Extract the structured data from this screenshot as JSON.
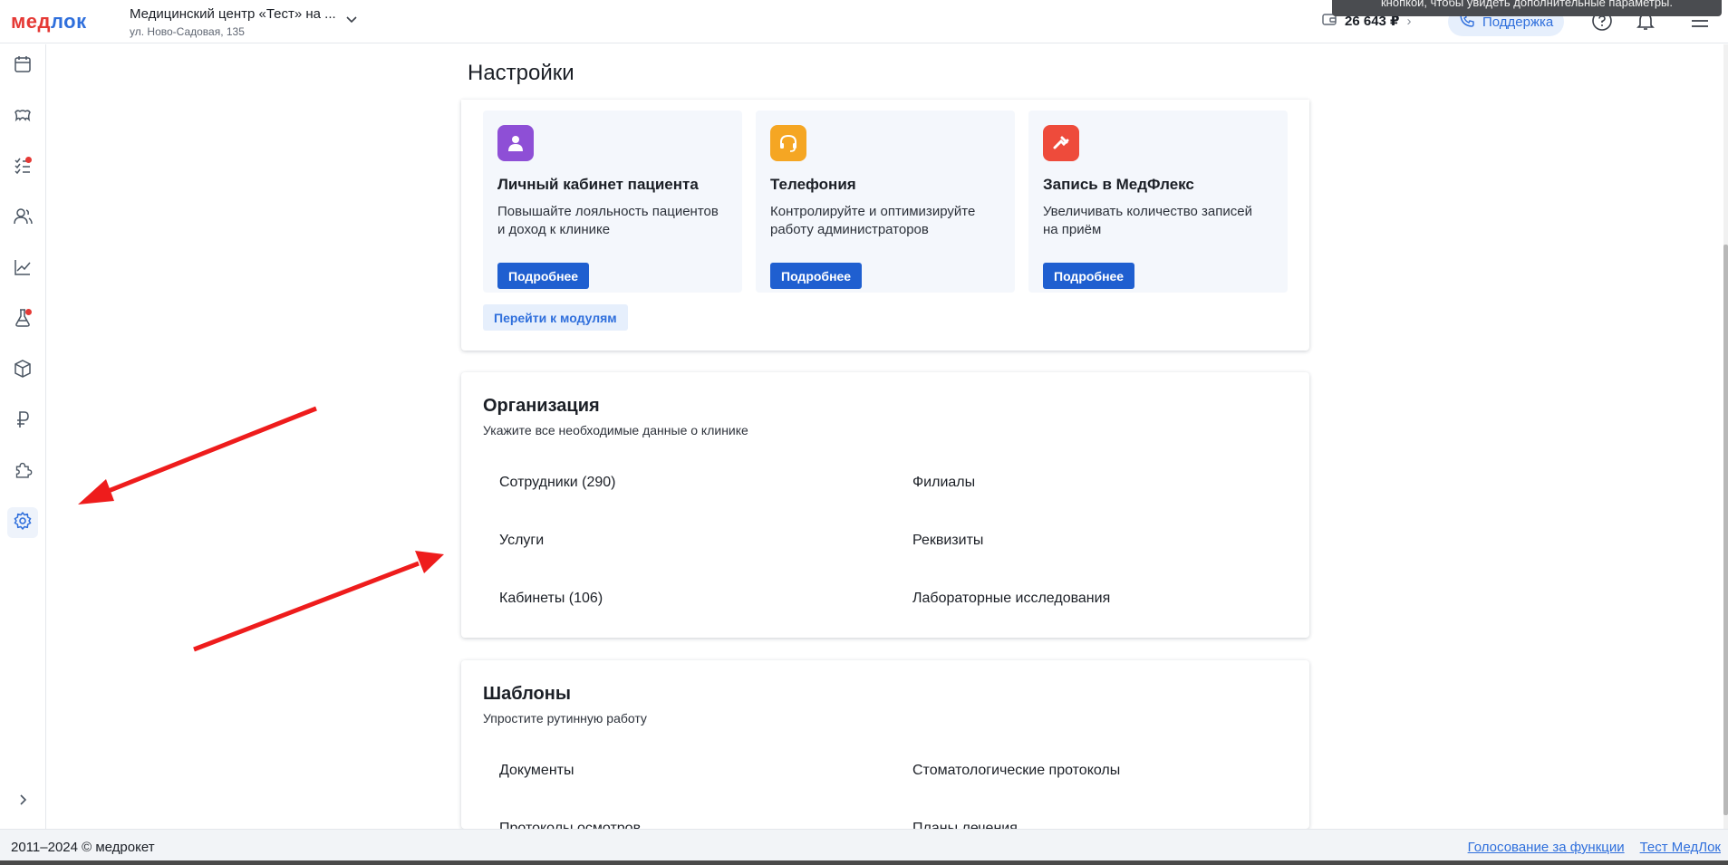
{
  "header": {
    "logo_part1": "мед",
    "logo_part2": "лок",
    "clinic_name": "Медицинский центр «Тест» на ...",
    "clinic_address": "ул. Ново-Садовая, 135",
    "balance": "26 643 ₽",
    "support_label": "Поддержка",
    "tooltip": "кнопкой, чтобы увидеть дополнительные параметры."
  },
  "sidebar": {
    "items": [
      {
        "icon": "calendar-icon"
      },
      {
        "icon": "tooth-icon"
      },
      {
        "icon": "tasks-icon",
        "badge": true
      },
      {
        "icon": "patients-icon"
      },
      {
        "icon": "analytics-icon"
      },
      {
        "icon": "lab-flask-icon",
        "badge": true
      },
      {
        "icon": "warehouse-box-icon"
      },
      {
        "icon": "ruble-icon"
      },
      {
        "icon": "puzzle-icon"
      },
      {
        "icon": "settings-gear-icon",
        "active": true
      }
    ]
  },
  "page": {
    "title": "Настройки"
  },
  "modules": {
    "items": [
      {
        "title": "Личный кабинет пациента",
        "desc": "Повышайте лояльность пациентов и доход к клинике",
        "button": "Подробнее",
        "color": "#8e4fd6"
      },
      {
        "title": "Телефония",
        "desc": "Контролируйте и оптимизируйте работу администраторов",
        "button": "Подробнее",
        "color": "#f5a623"
      },
      {
        "title": "Запись в МедФлекс",
        "desc": "Увеличивать количество записей на приём",
        "button": "Подробнее",
        "color": "#ee4b3b"
      }
    ],
    "go_button": "Перейти к модулям"
  },
  "organization": {
    "title": "Организация",
    "subtitle": "Укажите все необходимые данные о клинике",
    "links": [
      "Сотрудники (290)",
      "Филиалы",
      "Услуги",
      "Реквизиты",
      "Кабинеты (106)",
      "Лабораторные исследования"
    ]
  },
  "templates": {
    "title": "Шаблоны",
    "subtitle": "Упростите рутинную работу",
    "links": [
      "Документы",
      "Стоматологические протоколы",
      "Протоколы осмотров",
      "Планы лечения"
    ]
  },
  "footer": {
    "copyright": "2011–2024 © медрокет",
    "link_vote": "Голосование за функции",
    "link_test": "Тест МедЛок"
  },
  "colors": {
    "accent": "#2f6fdc",
    "button": "#1f5fd0",
    "annotation_arrow": "#ee1c1c"
  }
}
